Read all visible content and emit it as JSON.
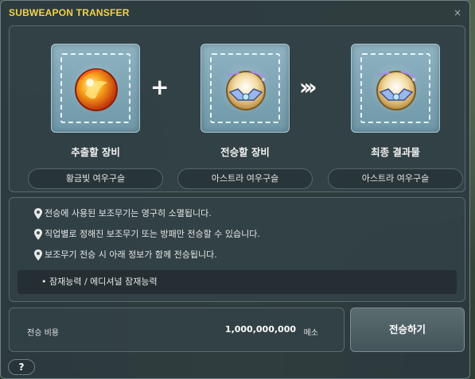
{
  "window": {
    "title": "SUBWEAPON TRANSFER",
    "close_symbol": "×"
  },
  "slots": [
    {
      "label": "추출할 장비",
      "item_name": "황금빛 여우구슬",
      "icon": "golden-fox-orb-icon"
    },
    {
      "label": "전승할 장비",
      "item_name": "아스트라 여우구슬",
      "icon": "astra-fox-orb-icon"
    },
    {
      "label": "최종 결과물",
      "item_name": "아스트라 여우구슬",
      "icon": "astra-fox-orb-icon"
    }
  ],
  "operators": {
    "plus": "+",
    "arrow": "»"
  },
  "info": {
    "lines": [
      "전승에 사용된 보조무기는 영구히 소멸됩니다.",
      "직업별로 정해진 보조무기 또는 방패만 전승할 수 있습니다.",
      "보조무기 전승 시 아래 정보가 함께 전승됩니다."
    ],
    "transferred_items": [
      "잠재능력 / 에디셔널 잠재능력"
    ]
  },
  "cost": {
    "label": "전승 비용",
    "value": "1,000,000,000",
    "unit": "메소"
  },
  "buttons": {
    "transfer": "전승하기",
    "help": "?"
  },
  "colors": {
    "title": "#f4d34a",
    "slot_bg": "#7fa6b6",
    "panel_bg": "#32424 6"
  }
}
